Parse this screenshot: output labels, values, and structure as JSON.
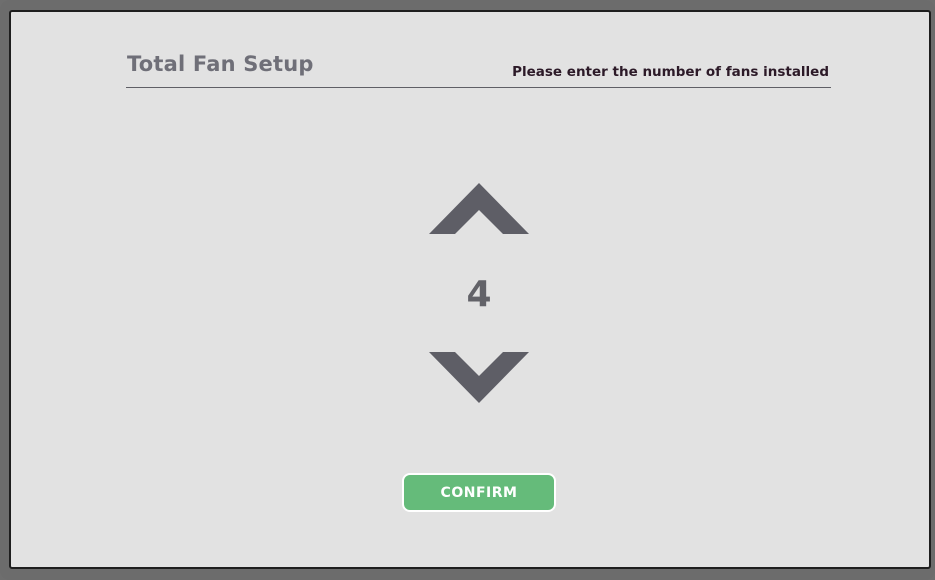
{
  "header": {
    "title": "Total Fan Setup",
    "instruction": "Please enter the number of fans installed"
  },
  "stepper": {
    "value": "4",
    "increment_icon": "chevron-up-icon",
    "decrement_icon": "chevron-down-icon"
  },
  "actions": {
    "confirm_label": "CONFIRM"
  },
  "colors": {
    "bezel": "#6c6c6c",
    "screen_background": "#e2e2e2",
    "title_text": "#6f6f78",
    "instruction_text": "#2c1a28",
    "chevron": "#5e5e66",
    "confirm_button": "#65bb7a",
    "confirm_text": "#ffffff"
  }
}
